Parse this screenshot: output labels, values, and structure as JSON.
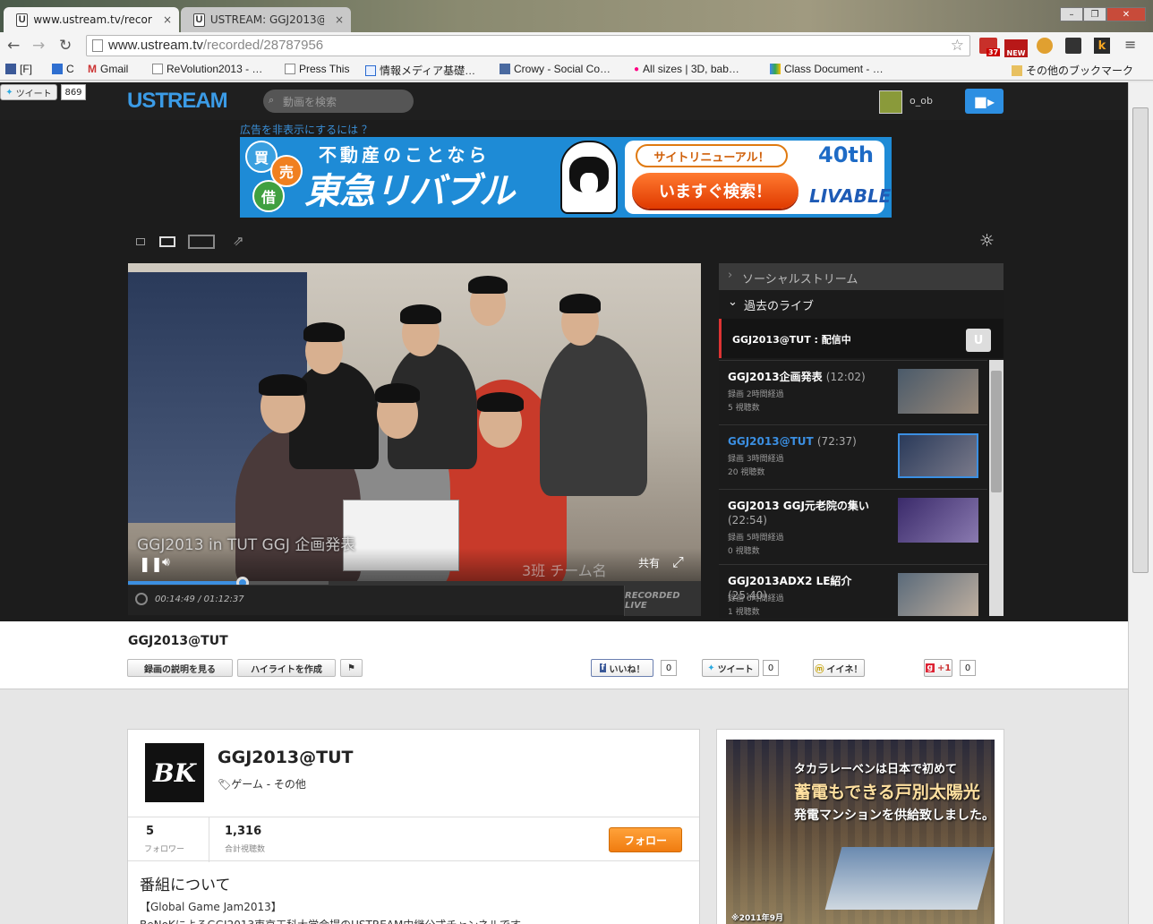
{
  "browser": {
    "tabs": [
      {
        "title": "www.ustream.tv/recorc",
        "close": "×"
      },
      {
        "title": "USTREAM: GGJ2013@T",
        "close": "×"
      }
    ],
    "url_host": "www.ustream.tv",
    "url_path": "/recorded/28787956",
    "bookmarks": [
      {
        "label": "[F]"
      },
      {
        "label": "C"
      },
      {
        "label": "Gmail"
      },
      {
        "label": "ReVolution2013 - …"
      },
      {
        "label": "Press This"
      },
      {
        "label": "情報メディア基礎…"
      },
      {
        "label": "Crowy - Social Co…"
      },
      {
        "label": "All sizes | 3D, bab…"
      },
      {
        "label": "Class Document - …"
      }
    ],
    "other_bookmarks": "その他のブックマーク",
    "ext_badges": {
      "count": "37",
      "new": "NEW"
    }
  },
  "social_float": {
    "tweet": "ツイート",
    "count": "869"
  },
  "ustream": {
    "logo": "USTREAM",
    "search_placeholder": "動画を検索",
    "username": "o_ob",
    "ad_hide_link": "広告を非表示にするには ？"
  },
  "banner": {
    "c1": "買",
    "c2": "売",
    "c3": "借",
    "headline": "不動産のことなら",
    "brand": "東急リバブル",
    "renewal": "サイトリニューアル！",
    "cta": "いますぐ検索！",
    "anniv": "40th",
    "logo": "LIVABLE"
  },
  "player": {
    "overlay_title": "GGJ2013 in TUT GGJ 企画発表",
    "overlay_team": "3班 チーム名",
    "share": "共有",
    "progress": 0.2,
    "buffered": 0.35,
    "time": "00:14:49 / 01:12:37",
    "recorded_badge": "RECORDED LIVE"
  },
  "sidebar": {
    "social_stream": "ソーシャルストリーム",
    "past_live": "過去のライブ",
    "live_item": "GGJ2013@TUT : 配信中",
    "items": [
      {
        "title": "GGJ2013企画発表",
        "duration": "(12:02)",
        "ago": "録画 2時間経過",
        "views": "5 視聴数",
        "active": false
      },
      {
        "title": "GGJ2013@TUT",
        "duration": "(72:37)",
        "ago": "録画 3時間経過",
        "views": "20 視聴数",
        "active": true
      },
      {
        "title": "GGJ2013 GGJ元老院の集い",
        "duration": "(22:54)",
        "ago": "録画 5時間経過",
        "views": "0 視聴数",
        "active": false
      },
      {
        "title": "GGJ2013ADX2 LE紹介",
        "duration": "(25:40)",
        "ago": "録画 6時間経過",
        "views": "1 視聴数",
        "active": false
      }
    ]
  },
  "info": {
    "title": "GGJ2013@TUT",
    "btn_desc": "録画の説明を見る",
    "btn_highlight": "ハイライトを作成",
    "fb_like": "いいね！",
    "fb_count": "0",
    "tw": "ツイート",
    "tw_count": "0",
    "mixi": "イイネ！",
    "gplus": "+1",
    "gplus_count": "0"
  },
  "channel": {
    "logo_text": "BK",
    "name": "GGJ2013@TUT",
    "category": "ゲーム - その他",
    "followers": "5",
    "followers_label": "フォロワー",
    "views": "1,316",
    "views_label": "合計視聴数",
    "follow": "フォロー",
    "about_title": "番組について",
    "about_line1": "【Global Game Jam2013】",
    "about_line2": "BeNoKによるGGJ2013東京工科大学会場のUSTREAM中継公式チャンネルです"
  },
  "side_ad": {
    "l1": "タカラレーベンは日本で初めて",
    "l2": "蓄電もできる戸別太陽光",
    "l3": "発電マンションを供給致しました。",
    "note": "※2011年9月"
  }
}
